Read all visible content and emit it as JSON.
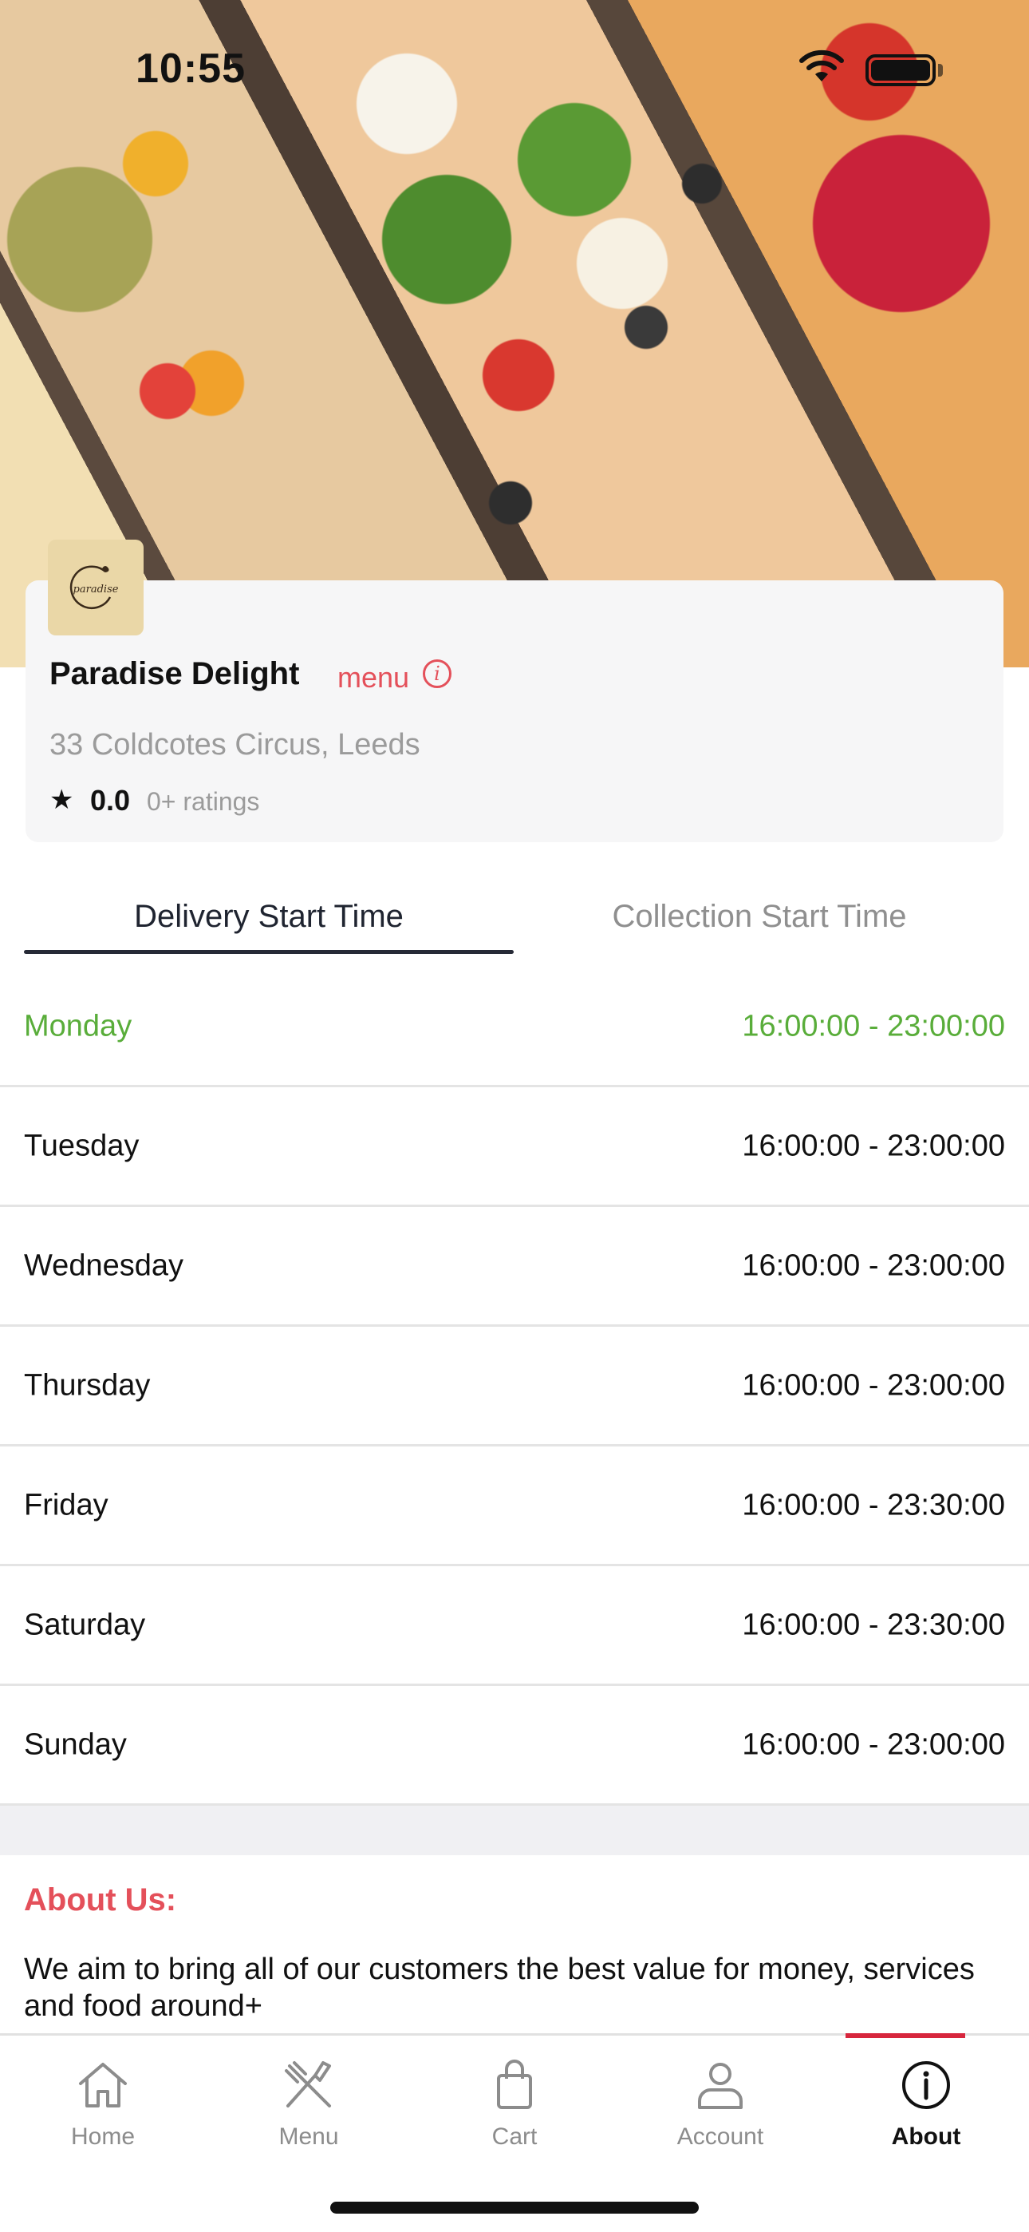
{
  "status_bar": {
    "time": "10:55"
  },
  "restaurant": {
    "name": "Paradise Delight",
    "menu_link": "menu",
    "address": "33 Coldcotes Circus, Leeds",
    "rating": "0.0",
    "rating_count": "0+ ratings",
    "logo_text": "paradise"
  },
  "tabs": [
    {
      "label": "Delivery Start Time",
      "active": true
    },
    {
      "label": "Collection Start Time",
      "active": false
    }
  ],
  "schedule": [
    {
      "day": "Monday",
      "hours": "16:00:00 - 23:00:00",
      "today": true
    },
    {
      "day": "Tuesday",
      "hours": "16:00:00 - 23:00:00"
    },
    {
      "day": "Wednesday",
      "hours": "16:00:00 - 23:00:00"
    },
    {
      "day": "Thursday",
      "hours": "16:00:00 - 23:00:00"
    },
    {
      "day": "Friday",
      "hours": "16:00:00 - 23:30:00"
    },
    {
      "day": "Saturday",
      "hours": "16:00:00 - 23:30:00"
    },
    {
      "day": "Sunday",
      "hours": "16:00:00 - 23:00:00"
    }
  ],
  "about": {
    "title": "About Us:",
    "text": "We aim to bring all of our customers the best value for money, services and food around+"
  },
  "bottom_nav": [
    {
      "label": "Home",
      "icon": "home-icon"
    },
    {
      "label": "Menu",
      "icon": "fork-knife-icon"
    },
    {
      "label": "Cart",
      "icon": "shopping-bag-icon"
    },
    {
      "label": "Account",
      "icon": "person-icon"
    },
    {
      "label": "About",
      "icon": "info-icon",
      "active": true
    }
  ],
  "colors": {
    "accent": "#e4505a",
    "today": "#59ad3a",
    "active_nav_bar": "#d7263d",
    "tab_underline": "#262a36"
  }
}
